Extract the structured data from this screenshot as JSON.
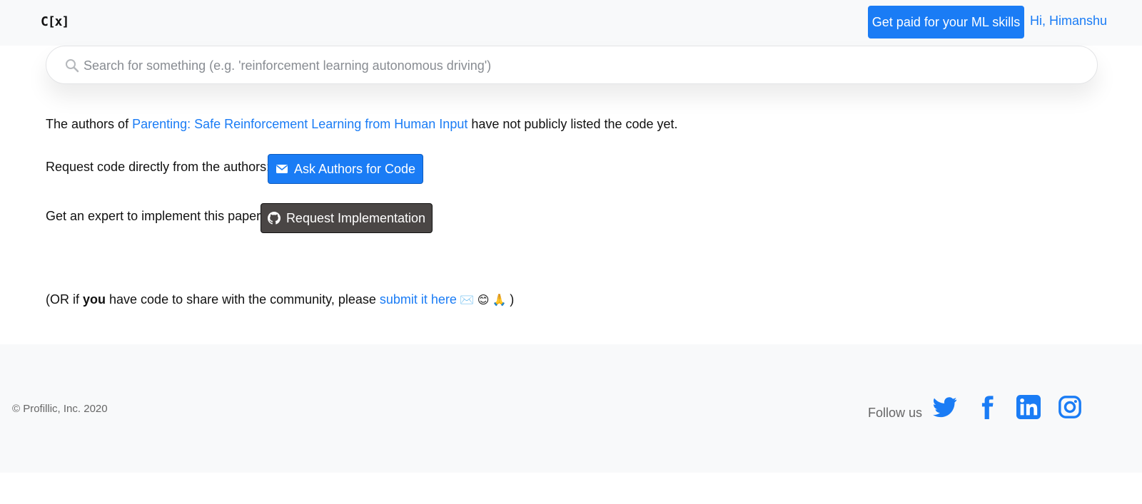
{
  "header": {
    "logo": "C[x]",
    "paid_button": "Get paid for your ML skills",
    "user_greeting": "Hi, Himanshu"
  },
  "search": {
    "placeholder": "Search for something (e.g. 'reinforcement learning autonomous driving')"
  },
  "main": {
    "line1_prefix": "The authors of ",
    "paper_title": "Parenting: Safe Reinforcement Learning from Human Input",
    "line1_suffix": " have not publicly listed the code yet.",
    "request_label": "Request code directly from the authors: ",
    "ask_button": "Ask Authors for Code",
    "expert_label": "Get an expert to implement this paper: ",
    "implement_button": "Request Implementation",
    "share_prefix": "(OR if ",
    "share_bold": "you",
    "share_middle": " have code to share with the community, please ",
    "share_link": "submit it here",
    "share_emojis": " ✉️ 😊 🙏 ",
    "share_suffix": ")"
  },
  "footer": {
    "copyright": "© Profillic, Inc. 2020",
    "follow_label": "Follow us",
    "social": [
      "twitter-icon",
      "facebook-icon",
      "linkedin-icon",
      "instagram-icon"
    ]
  },
  "colors": {
    "accent": "#1a7cf5",
    "dark_button": "#4a4645",
    "header_bg": "#f8f9fa"
  }
}
